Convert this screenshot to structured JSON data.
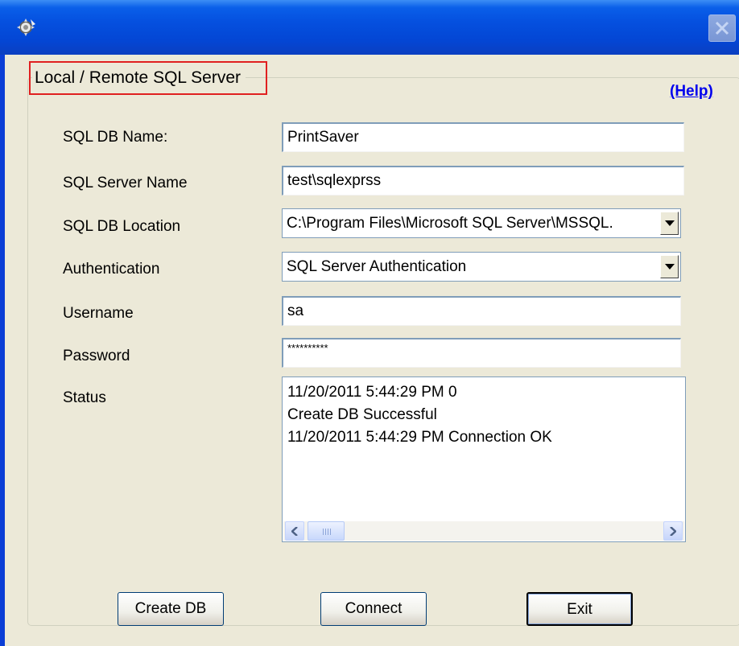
{
  "window": {
    "title": "",
    "icon": "app-gear-icon",
    "close_icon": "close-icon"
  },
  "group": {
    "label": "Local / Remote SQL Server",
    "help_link": "(Help)"
  },
  "form": {
    "db_name_label": "SQL DB Name:",
    "db_name_value": "PrintSaver",
    "server_label": "SQL Server Name",
    "server_value": "test\\sqlexprss",
    "location_label": "SQL DB Location",
    "location_value": "C:\\Program Files\\Microsoft SQL Server\\MSSQL.",
    "auth_label": "Authentication",
    "auth_value": "SQL Server Authentication",
    "username_label": "Username",
    "username_value": "sa",
    "password_label": "Password",
    "password_value": "**********",
    "status_label": "Status"
  },
  "status_lines": [
    "11/20/2011 5:44:29 PM 0",
    "Create DB Successful",
    "11/20/2011 5:44:29 PM Connection OK"
  ],
  "buttons": {
    "create_db": "Create DB",
    "connect": "Connect",
    "exit": "Exit"
  },
  "colors": {
    "titlebar": "#0550df",
    "dialog_bg": "#ece9d8",
    "highlight_box": "#e02020",
    "help_link": "#0000ee"
  }
}
